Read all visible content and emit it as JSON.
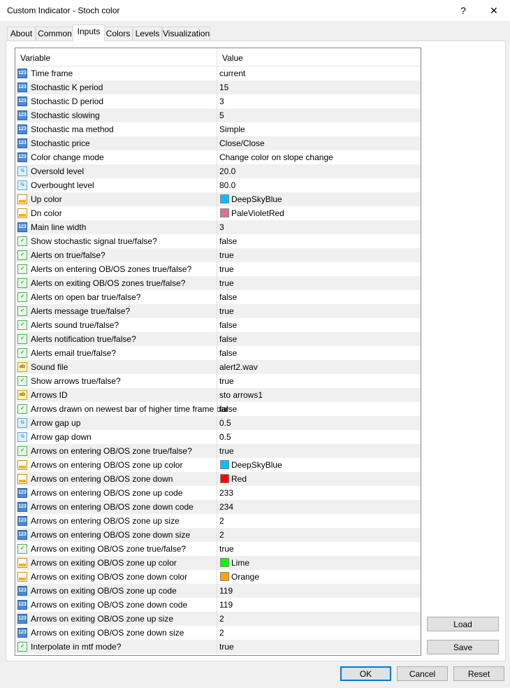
{
  "window": {
    "title": "Custom Indicator - Stoch color",
    "help": "?",
    "close": "✕"
  },
  "tabs": [
    "About",
    "Common",
    "Inputs",
    "Colors",
    "Levels",
    "Visualization"
  ],
  "active_tab": "Inputs",
  "grid": {
    "headers": {
      "variable": "Variable",
      "value": "Value"
    },
    "rows": [
      {
        "icon": "int",
        "name": "Time frame",
        "value": "current"
      },
      {
        "icon": "int",
        "name": "Stochastic K period",
        "value": "15"
      },
      {
        "icon": "int",
        "name": "Stochastic D period",
        "value": "3"
      },
      {
        "icon": "int",
        "name": "Stochastic slowing",
        "value": "5"
      },
      {
        "icon": "int",
        "name": "Stochastic ma method",
        "value": "Simple"
      },
      {
        "icon": "int",
        "name": "Stochastic price",
        "value": "Close/Close"
      },
      {
        "icon": "int",
        "name": "Color change mode",
        "value": "Change color on slope change"
      },
      {
        "icon": "dbl",
        "name": "Oversold level",
        "value": "20.0"
      },
      {
        "icon": "dbl",
        "name": "Overbought level",
        "value": "80.0"
      },
      {
        "icon": "col",
        "name": "Up color",
        "value": "DeepSkyBlue",
        "swatch": "#00bfff"
      },
      {
        "icon": "col",
        "name": "Dn color",
        "value": "PaleVioletRed",
        "swatch": "#db7093"
      },
      {
        "icon": "int",
        "name": "Main line width",
        "value": "3"
      },
      {
        "icon": "bool",
        "name": "Show stochastic signal true/false?",
        "value": "false"
      },
      {
        "icon": "bool",
        "name": "Alerts on true/false?",
        "value": "true"
      },
      {
        "icon": "bool",
        "name": "Alerts on entering OB/OS zones true/false?",
        "value": "true"
      },
      {
        "icon": "bool",
        "name": "Alerts on exiting OB/OS zones true/false?",
        "value": "true"
      },
      {
        "icon": "bool",
        "name": "Alerts on open bar true/false?",
        "value": "false"
      },
      {
        "icon": "bool",
        "name": "Alerts message true/false?",
        "value": "true"
      },
      {
        "icon": "bool",
        "name": "Alerts sound true/false?",
        "value": "false"
      },
      {
        "icon": "bool",
        "name": "Alerts notification true/false?",
        "value": "false"
      },
      {
        "icon": "bool",
        "name": "Alerts email true/false?",
        "value": "false"
      },
      {
        "icon": "str",
        "name": "Sound file",
        "value": "alert2.wav"
      },
      {
        "icon": "bool",
        "name": "Show arrows true/false?",
        "value": "true"
      },
      {
        "icon": "str",
        "name": "Arrows ID",
        "value": "sto arrows1"
      },
      {
        "icon": "bool",
        "name": "Arrows drawn on newest bar of higher time frame bar",
        "value": "false"
      },
      {
        "icon": "dbl",
        "name": "Arrow gap up",
        "value": "0.5"
      },
      {
        "icon": "dbl",
        "name": "Arrow gap down",
        "value": "0.5"
      },
      {
        "icon": "bool",
        "name": "Arrows on entering OB/OS zone true/false?",
        "value": "true"
      },
      {
        "icon": "col",
        "name": "Arrows on entering OB/OS zone up color",
        "value": "DeepSkyBlue",
        "swatch": "#00bfff"
      },
      {
        "icon": "col",
        "name": "Arrows on entering OB/OS zone down",
        "value": "Red",
        "swatch": "#ff0000"
      },
      {
        "icon": "int",
        "name": "Arrows on entering OB/OS zone up code",
        "value": "233"
      },
      {
        "icon": "int",
        "name": "Arrows on entering OB/OS zone down code",
        "value": "234"
      },
      {
        "icon": "int",
        "name": "Arrows on entering OB/OS zone up size",
        "value": "2"
      },
      {
        "icon": "int",
        "name": "Arrows on entering OB/OS zone down size",
        "value": "2"
      },
      {
        "icon": "bool",
        "name": "Arrows on exiting OB/OS zone true/false?",
        "value": "true"
      },
      {
        "icon": "col",
        "name": "Arrows on exiting OB/OS zone up color",
        "value": "Lime",
        "swatch": "#00ff00"
      },
      {
        "icon": "col",
        "name": "Arrows on exiting OB/OS zone down color",
        "value": "Orange",
        "swatch": "#ffa500"
      },
      {
        "icon": "int",
        "name": "Arrows on exiting OB/OS zone up code",
        "value": "119"
      },
      {
        "icon": "int",
        "name": "Arrows on exiting OB/OS zone down code",
        "value": "119"
      },
      {
        "icon": "int",
        "name": "Arrows on exiting OB/OS zone up size",
        "value": "2"
      },
      {
        "icon": "int",
        "name": "Arrows on exiting OB/OS zone down size",
        "value": "2"
      },
      {
        "icon": "bool",
        "name": "Interpolate in mtf mode?",
        "value": "true"
      }
    ]
  },
  "side_buttons": {
    "load": "Load",
    "save": "Save"
  },
  "footer_buttons": {
    "ok": "OK",
    "cancel": "Cancel",
    "reset": "Reset"
  }
}
